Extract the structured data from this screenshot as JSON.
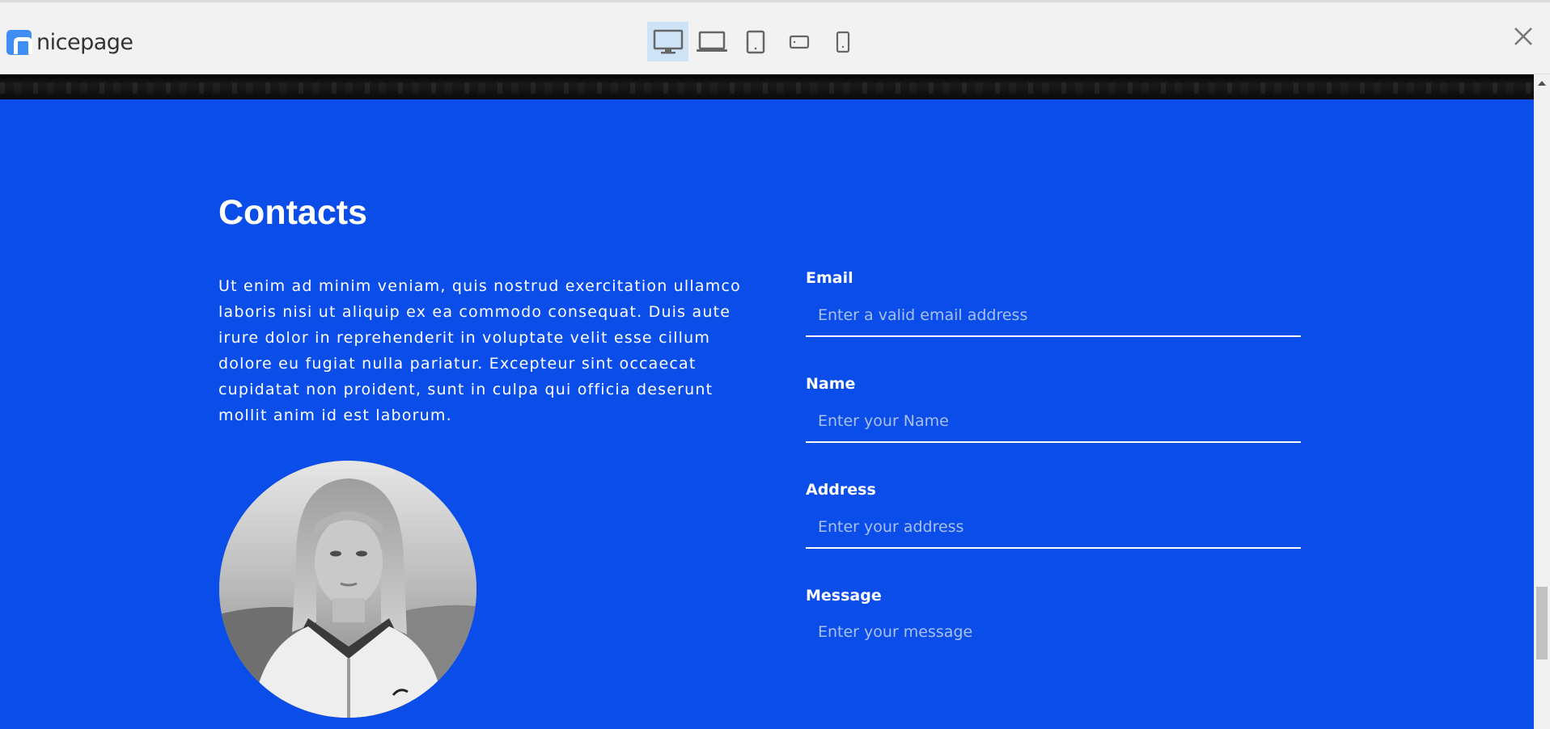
{
  "toolbar": {
    "brand": "nicepage",
    "icons": {
      "logo": "nicepage-logo-icon",
      "desktop": "desktop-monitor-icon",
      "laptop": "laptop-icon",
      "tablet": "tablet-portrait-icon",
      "tablet_landscape": "phone-landscape-icon",
      "phone": "phone-portrait-icon",
      "close": "close-icon"
    },
    "active_device": "desktop"
  },
  "contacts": {
    "title": "Contacts",
    "text": "Ut enim ad minim veniam, quis nostrud exercitation ullamco laboris nisi ut aliquip ex ea commodo consequat. Duis aute irure dolor in reprehenderit in voluptate velit esse cillum dolore eu fugiat nulla pariatur. Excepteur sint occaecat cupidatat non proident, sunt in culpa qui officia deserunt mollit anim id est laborum.",
    "image": "portrait-photo"
  },
  "form": {
    "email": {
      "label": "Email",
      "placeholder": "Enter a valid email address"
    },
    "name": {
      "label": "Name",
      "placeholder": "Enter your Name"
    },
    "address": {
      "label": "Address",
      "placeholder": "Enter your address"
    },
    "message": {
      "label": "Message",
      "placeholder": "Enter your message"
    }
  },
  "colors": {
    "section_bg": "#0b4de9",
    "toolbar_bg": "#f2f2f2",
    "active_device_bg": "#cfe3f6",
    "brand_blue": "#3f8ef3"
  }
}
